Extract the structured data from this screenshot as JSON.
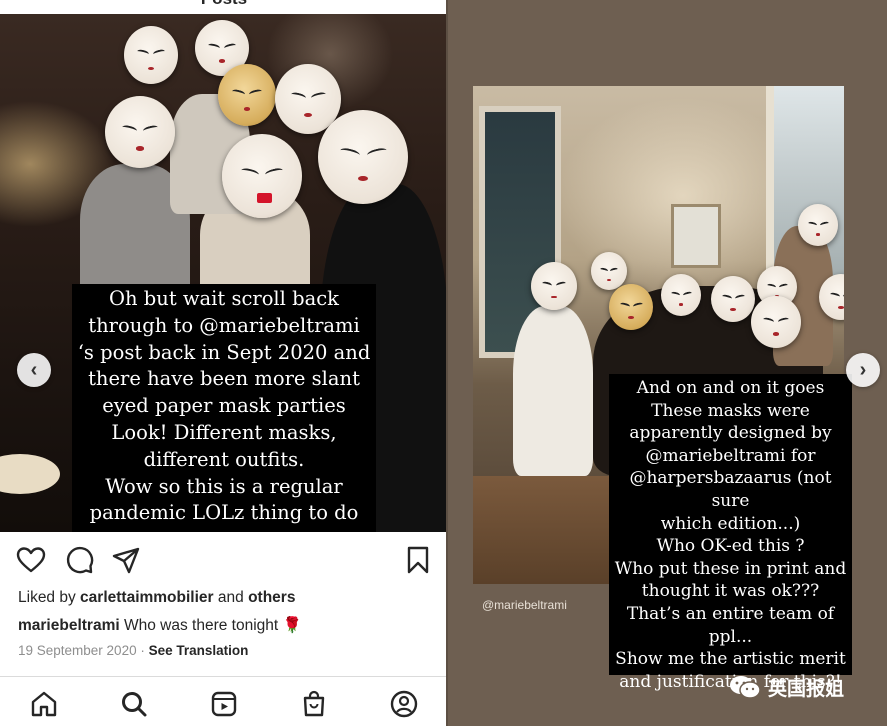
{
  "left_post": {
    "top_title": "Posts",
    "caption_overlay": [
      "Oh but wait scroll back",
      "through to @mariebeltrami",
      "‘s post back in Sept 2020 and",
      "there have been more slant",
      "eyed paper mask parties",
      "Look! Different masks,",
      "different outfits.",
      "Wow so this is a regular",
      "pandemic LOLz thing to do"
    ],
    "actions": {
      "like_icon": "heart-icon",
      "comment_icon": "comment-icon",
      "share_icon": "send-icon",
      "save_icon": "bookmark-icon"
    },
    "liked_by": {
      "prefix": "Liked by ",
      "user": "carlettaimmobilier",
      "middle": " and ",
      "others": "others"
    },
    "caption": {
      "user": "mariebeltrami",
      "text": " Who was there tonight 🌹"
    },
    "date": "19 September 2020",
    "separator": " · ",
    "see_translation": "See Translation",
    "tab_bar": [
      "home-icon",
      "search-icon",
      "reels-icon",
      "shop-icon",
      "profile-icon"
    ],
    "prev_arrow": "‹"
  },
  "right_story": {
    "handle_tag": "@mariebeltrami",
    "caption_overlay": [
      "And on and on it goes",
      "These masks were",
      "apparently designed by",
      "@mariebeltrami for",
      "@harpersbazaarus (not sure",
      "which edition...)",
      "Who OK-ed this ?",
      "Who put these in print and",
      "thought it was ok???",
      "That’s an entire team of",
      "ppl...",
      "Show me the artistic merit",
      "and justification for this?!"
    ],
    "next_arrow": "›"
  },
  "watermark": {
    "text": "英国报姐",
    "icon": "wechat-icon"
  },
  "colors": {
    "caption_bg": "#000000",
    "caption_text": "#ffffff",
    "rose": "#c0202a"
  }
}
